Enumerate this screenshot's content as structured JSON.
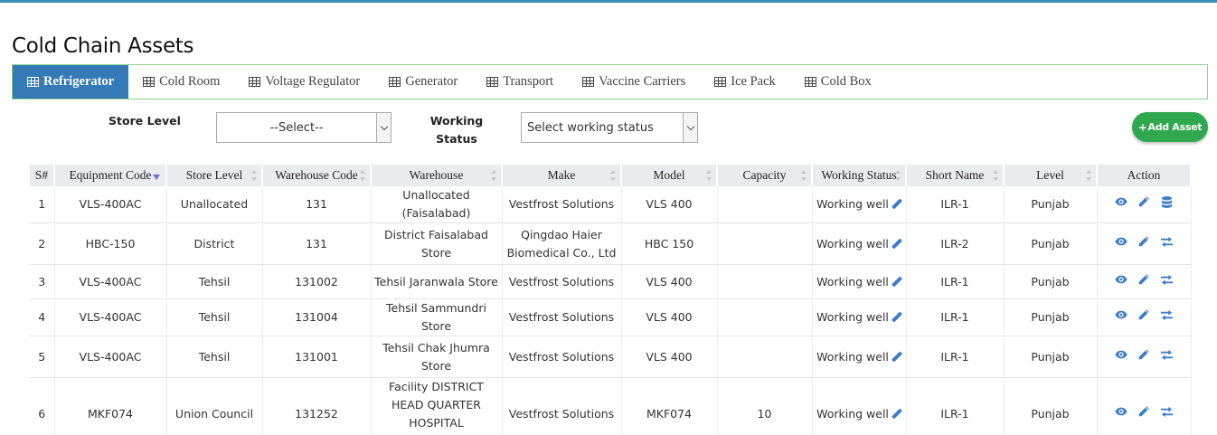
{
  "page": {
    "title": "Cold Chain Assets"
  },
  "tabs": [
    {
      "label": "Refrigerator",
      "active": true
    },
    {
      "label": "Cold Room",
      "active": false
    },
    {
      "label": "Voltage Regulator",
      "active": false
    },
    {
      "label": "Generator",
      "active": false
    },
    {
      "label": "Transport",
      "active": false
    },
    {
      "label": "Vaccine Carriers",
      "active": false
    },
    {
      "label": "Ice Pack",
      "active": false
    },
    {
      "label": "Cold Box",
      "active": false
    }
  ],
  "filters": {
    "store_level_label": "Store Level",
    "store_level_value": "--Select--",
    "working_label_line1": "Working",
    "working_label_line2": "Status",
    "working_value": "Select working status"
  },
  "add_button": {
    "label": "Add Asset",
    "icon": "plus-icon"
  },
  "table": {
    "headers": [
      "S#",
      "Equipment Code",
      "Store Level",
      "Warehouse Code",
      "Warehouse",
      "Make",
      "Model",
      "Capacity",
      "Working Status",
      "Short Name",
      "Level",
      "Action"
    ],
    "rows": [
      {
        "sn": "1",
        "code": "VLS-400AC",
        "store_level": "Unallocated",
        "wh_code": "131",
        "warehouse": "Unallocated (Faisalabad)",
        "make": "Vestfrost Solutions",
        "model": "VLS 400",
        "capacity": "",
        "status": "Working well",
        "short": "ILR-1",
        "level": "Punjab",
        "third_action": "database-icon"
      },
      {
        "sn": "2",
        "code": "HBC-150",
        "store_level": "District",
        "wh_code": "131",
        "warehouse": "District Faisalabad Store",
        "make": "Qingdao Haier Biomedical Co., Ltd",
        "model": "HBC 150",
        "capacity": "",
        "status": "Working well",
        "short": "ILR-2",
        "level": "Punjab",
        "third_action": "transfer-icon"
      },
      {
        "sn": "3",
        "code": "VLS-400AC",
        "store_level": "Tehsil",
        "wh_code": "131002",
        "warehouse": "Tehsil Jaranwala Store",
        "make": "Vestfrost Solutions",
        "model": "VLS 400",
        "capacity": "",
        "status": "Working well",
        "short": "ILR-1",
        "level": "Punjab",
        "third_action": "transfer-icon"
      },
      {
        "sn": "4",
        "code": "VLS-400AC",
        "store_level": "Tehsil",
        "wh_code": "131004",
        "warehouse": "Tehsil Sammundri Store",
        "make": "Vestfrost Solutions",
        "model": "VLS 400",
        "capacity": "",
        "status": "Working well",
        "short": "ILR-1",
        "level": "Punjab",
        "third_action": "transfer-icon"
      },
      {
        "sn": "5",
        "code": "VLS-400AC",
        "store_level": "Tehsil",
        "wh_code": "131001",
        "warehouse": "Tehsil Chak Jhumra Store",
        "make": "Vestfrost Solutions",
        "model": "VLS 400",
        "capacity": "",
        "status": "Working well",
        "short": "ILR-1",
        "level": "Punjab",
        "third_action": "transfer-icon"
      },
      {
        "sn": "6",
        "code": "MKF074",
        "store_level": "Union Council",
        "wh_code": "131252",
        "warehouse": "Facility DISTRICT HEAD QUARTER HOSPITAL FAISALABAD Store",
        "make": "Vestfrost Solutions",
        "model": "MKF074",
        "capacity": "10",
        "status": "Working well",
        "short": "ILR-1",
        "level": "Punjab",
        "third_action": "transfer-icon"
      }
    ]
  },
  "colors": {
    "accent": "#337ab7",
    "tab_border": "#8fd18f",
    "add_button": "#2fa84f",
    "icon": "#3d7cc9",
    "top_bar": "#3c8dbc"
  }
}
